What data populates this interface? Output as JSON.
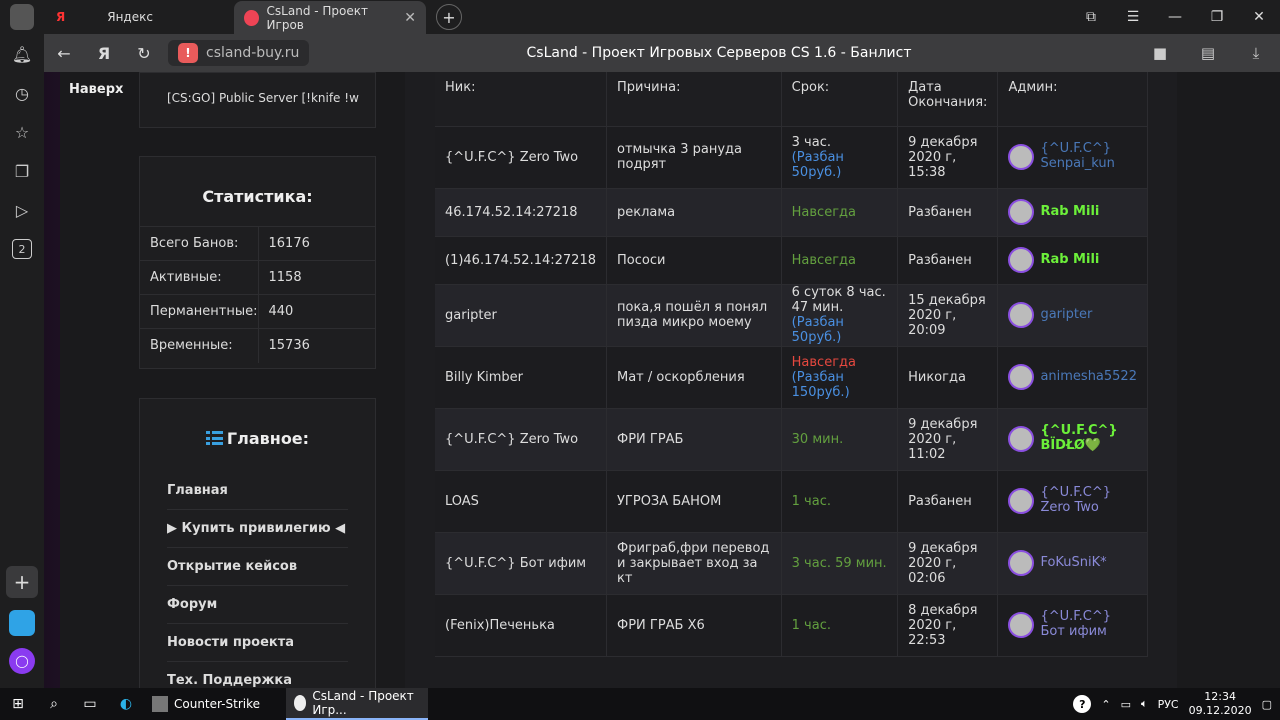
{
  "tabs": [
    {
      "label": "Яндекс",
      "icon": "yandex-icon",
      "active": false
    },
    {
      "label": "CsLand - Проект Игров",
      "icon": "csland-icon",
      "active": true
    }
  ],
  "address": {
    "site": "csland-buy.ru",
    "title": "CsLand - Проект Игровых Серверов CS 1.6 - Банлист"
  },
  "sidebar_badge": "2",
  "left": {
    "top_link": "Наверх",
    "server": "[CS:GO] Public Server [!knife !w",
    "stats": {
      "title": "Статистика:",
      "rows": [
        {
          "label": "Всего Банов:",
          "value": "16176"
        },
        {
          "label": "Активные:",
          "value": "1158"
        },
        {
          "label": "Перманентные:",
          "value": "440"
        },
        {
          "label": "Временные:",
          "value": "15736"
        }
      ]
    },
    "menu": {
      "title": "Главное:",
      "items": [
        "Главная",
        "▶ Купить привилегию ◀",
        "Открытие кейсов",
        "Форум",
        "Новости проекта",
        "Тех. Поддержка"
      ]
    }
  },
  "bans": {
    "headers": [
      "Ник:",
      "Причина:",
      "Срок:",
      "Дата Окончания:",
      "Админ:"
    ],
    "rows": [
      {
        "nick": "{^U.F.C^} Zero Two",
        "reason": "отмычка 3 рануда подрят",
        "term": "3 час.",
        "term_extra": "(Разбан 50руб.)",
        "term_class": "",
        "date": "9 декабря 2020 г, 15:38",
        "admin": "{^U.F.C^} Senpai_kun",
        "admin_class": "adm-link"
      },
      {
        "nick": "46.174.52.14:27218",
        "reason": "реклама",
        "term": "Навсегда",
        "term_extra": "",
        "term_class": "green",
        "date": "Разбанен",
        "admin": "Rab Mili",
        "admin_class": "adm-green"
      },
      {
        "nick": "(1)46.174.52.14:27218",
        "reason": "Пососи",
        "term": "Навсегда",
        "term_extra": "",
        "term_class": "green",
        "date": "Разбанен",
        "admin": "Rab Mili",
        "admin_class": "adm-green"
      },
      {
        "nick": "garipter",
        "reason": "пока,я пошёл я понял пизда микро моему",
        "term": "6 суток 8 час. 47 мин.",
        "term_extra": "(Разбан 50руб.)",
        "term_class": "",
        "date": "15 декабря 2020 г, 20:09",
        "admin": "garipter",
        "admin_class": "adm-link"
      },
      {
        "nick": "Billy Kimber",
        "reason": "Мат / оскорбления",
        "term": "Навсегда",
        "term_extra": "(Разбан 150руб.)",
        "term_class": "red",
        "date": "Никогда",
        "admin": "animesha5522",
        "admin_class": "adm-link"
      },
      {
        "nick": "{^U.F.C^} Zero Two",
        "reason": "ФРИ ГРАБ",
        "term": "30 мин.",
        "term_extra": "",
        "term_class": "green",
        "date": "9 декабря 2020 г, 11:02",
        "admin": "{^U.F.C^} ВÏDŁØ💚",
        "admin_class": "adm-green"
      },
      {
        "nick": "LOAS",
        "reason": "УГРОЗА БАНОМ",
        "term": "1 час.",
        "term_extra": "",
        "term_class": "green",
        "date": "Разбанен",
        "admin": "{^U.F.C^} Zero Two",
        "admin_class": "adm-purple"
      },
      {
        "nick": "{^U.F.C^} Бот ифим",
        "reason": "Фриграб,фри перевод и закрывает вход за кт",
        "term": "3 час. 59 мин.",
        "term_extra": "",
        "term_class": "green",
        "date": "9 декабря 2020 г, 02:06",
        "admin": "FoKuSniK*",
        "admin_class": "adm-purple"
      },
      {
        "nick": "(Fenix)Печенька",
        "reason": "ФРИ ГРАБ Х6",
        "term": "1 час.",
        "term_extra": "",
        "term_class": "green",
        "date": "8 декабря 2020 г, 22:53",
        "admin": "{^U.F.C^} Бот ифим",
        "admin_class": "adm-purple"
      }
    ]
  },
  "taskbar": {
    "apps": [
      {
        "label": "Counter-Strike"
      },
      {
        "label": "CsLand - Проект Игр..."
      }
    ],
    "lang": "РУС",
    "time": "12:34",
    "date": "09.12.2020"
  }
}
